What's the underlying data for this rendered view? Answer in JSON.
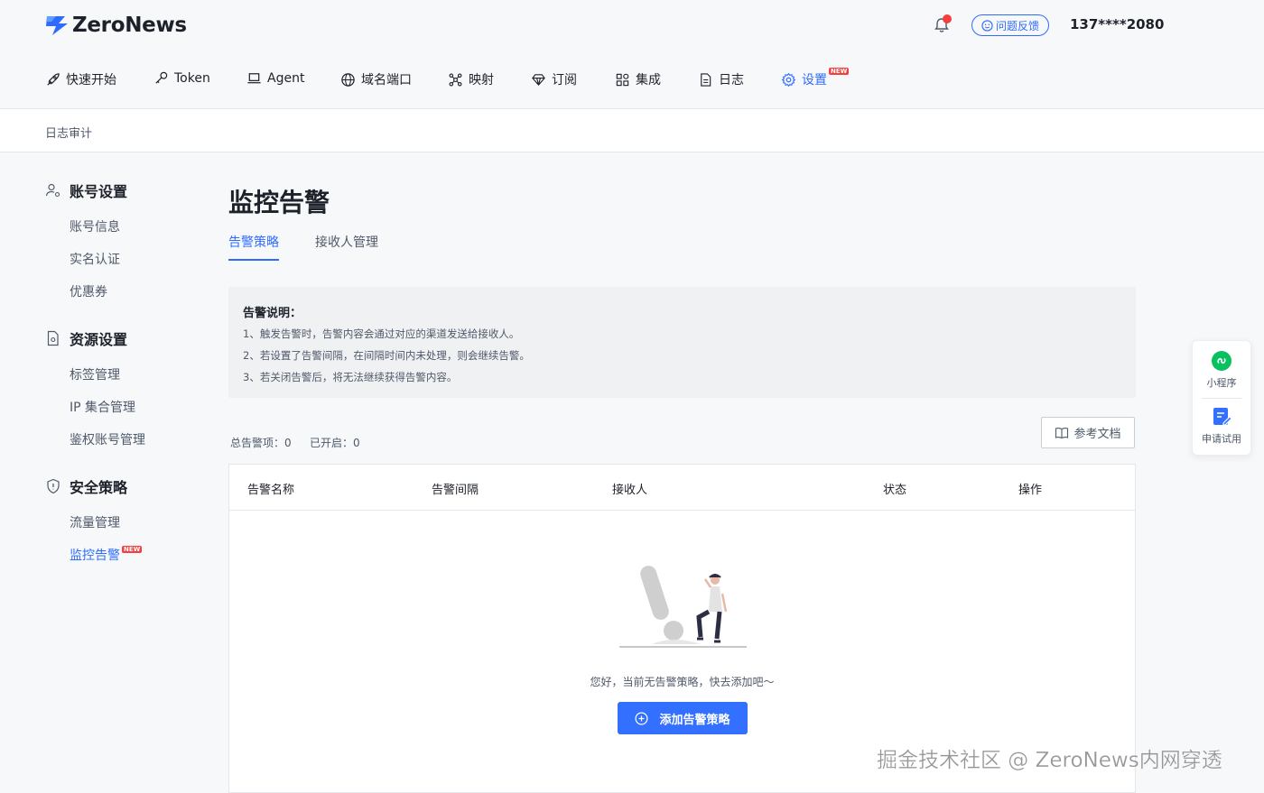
{
  "header": {
    "brand": "ZeroNews",
    "feedback_label": "问题反馈",
    "phone": "137****2080"
  },
  "nav": {
    "items": [
      {
        "label": "快速开始",
        "icon": "rocket-icon"
      },
      {
        "label": "Token",
        "icon": "key-icon"
      },
      {
        "label": "Agent",
        "icon": "laptop-icon"
      },
      {
        "label": "域名端口",
        "icon": "globe-icon"
      },
      {
        "label": "映射",
        "icon": "network-icon"
      },
      {
        "label": "订阅",
        "icon": "diamond-icon"
      },
      {
        "label": "集成",
        "icon": "apps-icon"
      },
      {
        "label": "日志",
        "icon": "file-icon"
      },
      {
        "label": "设置",
        "icon": "gear-icon",
        "active": true,
        "badge": "NEW"
      }
    ]
  },
  "breadcrumb": "日志审计",
  "sidebar": {
    "groups": [
      {
        "title": "账号设置",
        "icon": "user-settings-icon",
        "items": [
          "账号信息",
          "实名认证",
          "优惠券"
        ]
      },
      {
        "title": "资源设置",
        "icon": "file-settings-icon",
        "items": [
          "标签管理",
          "IP 集合管理",
          "鉴权账号管理"
        ]
      },
      {
        "title": "安全策略",
        "icon": "shield-icon",
        "items": [
          "流量管理",
          "监控告警"
        ]
      }
    ],
    "active_item": "监控告警",
    "active_badge": "NEW"
  },
  "main": {
    "title": "监控告警",
    "tabs": [
      {
        "label": "告警策略",
        "active": true
      },
      {
        "label": "接收人管理",
        "active": false
      }
    ],
    "notice": {
      "title": "告警说明：",
      "lines": [
        "1、触发告警时，告警内容会通过对应的渠道发送给接收人。",
        "2、若设置了告警间隔，在间隔时间内未处理，则会继续告警。",
        "3、若关闭告警后，将无法继续获得告警内容。"
      ]
    },
    "stats": {
      "total_label": "总告警项：",
      "total_value": "0",
      "enabled_label": "已开启：",
      "enabled_value": "0"
    },
    "doc_button": "参考文档",
    "table": {
      "columns": [
        "告警名称",
        "告警间隔",
        "接收人",
        "状态",
        "操作"
      ],
      "rows": [],
      "empty_text": "您好，当前无告警策略，快去添加吧～",
      "add_button": "添加告警策略"
    }
  },
  "float_panel": {
    "items": [
      {
        "label": "小程序",
        "icon": "mini-program-icon"
      },
      {
        "label": "申请试用",
        "icon": "apply-trial-icon"
      }
    ]
  },
  "watermark": "掘金技术社区 @ ZeroNews内网穿透",
  "colors": {
    "accent": "#2f6bff",
    "button": "#3370ff",
    "badge": "#f53f3f",
    "mini_program": "#07c160"
  }
}
